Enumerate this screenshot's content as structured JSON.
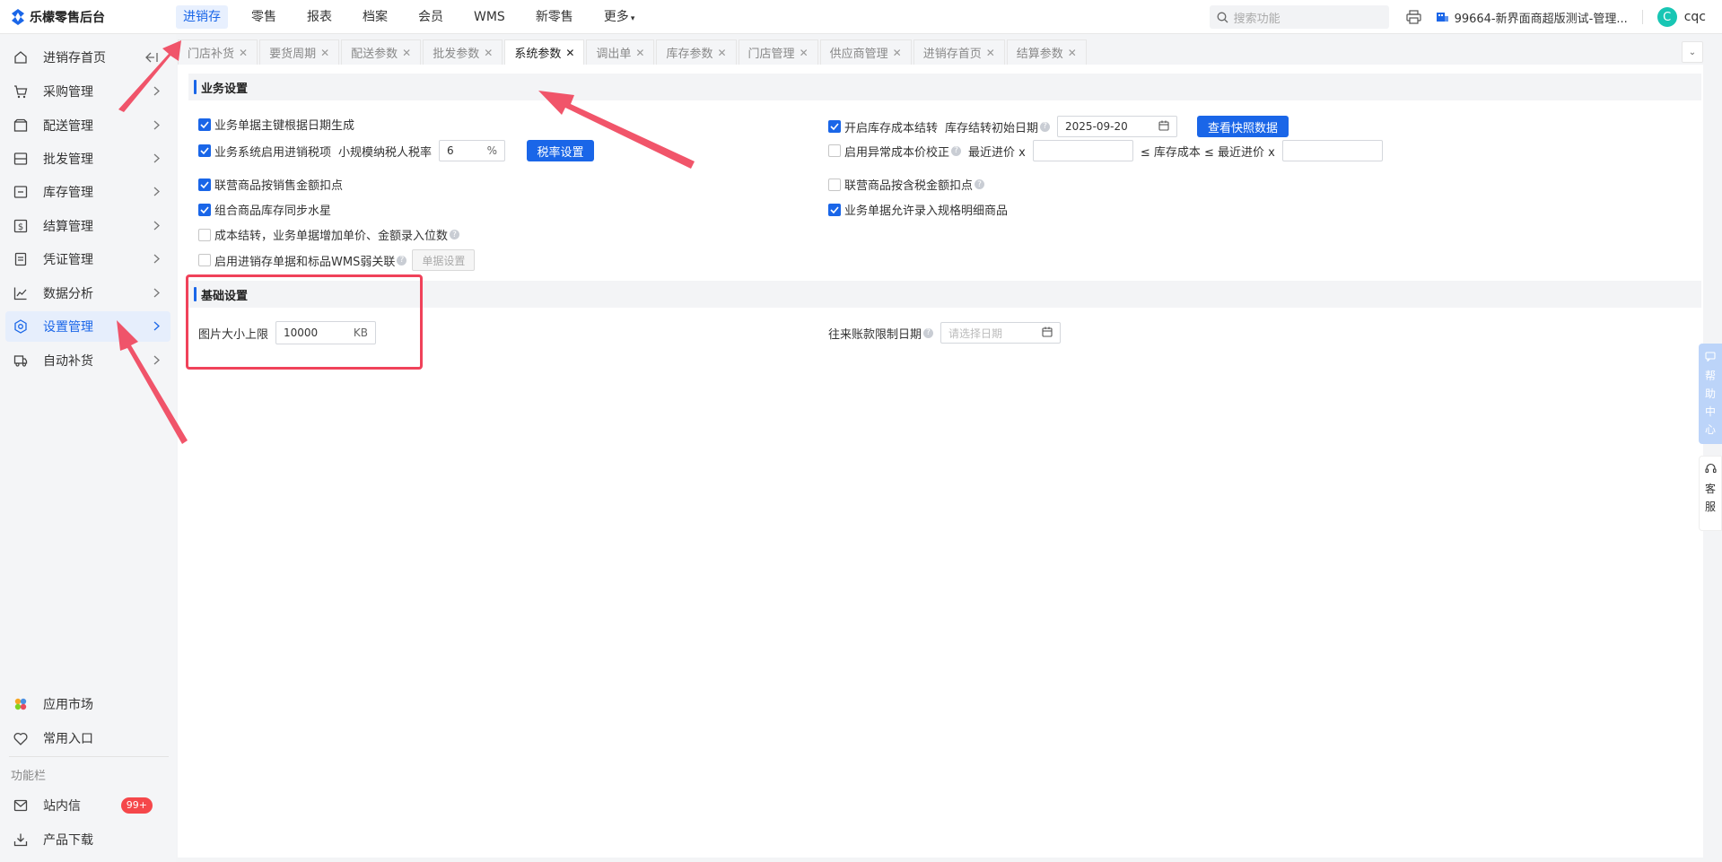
{
  "app": {
    "logo_text": "乐檬零售后台"
  },
  "topnav": {
    "items": [
      {
        "label": "进销存",
        "active": true
      },
      {
        "label": "零售"
      },
      {
        "label": "报表"
      },
      {
        "label": "档案"
      },
      {
        "label": "会员"
      },
      {
        "label": "WMS"
      },
      {
        "label": "新零售"
      },
      {
        "label": "更多"
      }
    ],
    "search_placeholder": "搜索功能",
    "store_name": "99664-新界面商超版测试-管理...",
    "user_initial": "C",
    "user_name": "cqc"
  },
  "sidebar": {
    "items": [
      {
        "label": "进销存首页"
      },
      {
        "label": "采购管理"
      },
      {
        "label": "配送管理"
      },
      {
        "label": "批发管理"
      },
      {
        "label": "库存管理"
      },
      {
        "label": "结算管理"
      },
      {
        "label": "凭证管理"
      },
      {
        "label": "数据分析"
      },
      {
        "label": "设置管理",
        "active": true
      },
      {
        "label": "自动补货"
      }
    ],
    "bottom": {
      "app_market": "应用市场",
      "favorites": "常用入口",
      "function_bar_label": "功能栏",
      "messages": "站内信",
      "messages_badge": "99+",
      "downloads": "产品下载"
    }
  },
  "tabs": [
    {
      "label": "门店补货"
    },
    {
      "label": "要货周期"
    },
    {
      "label": "配送参数"
    },
    {
      "label": "批发参数"
    },
    {
      "label": "系统参数",
      "active": true
    },
    {
      "label": "调出单"
    },
    {
      "label": "库存参数"
    },
    {
      "label": "门店管理"
    },
    {
      "label": "供应商管理"
    },
    {
      "label": "进销存首页"
    },
    {
      "label": "结算参数"
    }
  ],
  "business": {
    "title": "业务设置",
    "left": {
      "r1": {
        "label": "业务单据主键根据日期生成",
        "checked": true
      },
      "r2": {
        "label": "业务系统启用进销税项",
        "checked": true,
        "tax_label": "小规模纳税人税率",
        "tax_value": "6",
        "tax_unit": "%",
        "tax_button": "税率设置"
      },
      "r3": {
        "label": "联营商品按销售金额扣点",
        "checked": true
      },
      "r4": {
        "label": "组合商品库存同步水星",
        "checked": true
      },
      "r5": {
        "label": "成本结转，业务单据增加单价、金额录入位数",
        "checked": false
      },
      "r6": {
        "label": "启用进销存单据和标品WMS弱关联",
        "checked": false,
        "button": "单据设置"
      }
    },
    "right": {
      "r1": {
        "label": "开启库存成本结转",
        "checked": true,
        "date_label": "库存结转初始日期",
        "date_value": "2025-09-20",
        "button": "查看快照数据"
      },
      "r2": {
        "label": "启用异常成本价校正",
        "checked": false,
        "min_label": "最近进价 x",
        "mid_label": "≤ 库存成本 ≤ 最近进价 x"
      },
      "r3": {
        "label": "联营商品按含税金额扣点",
        "checked": false
      },
      "r4": {
        "label": "业务单据允许录入规格明细商品",
        "checked": true
      }
    }
  },
  "basic": {
    "title": "基础设置",
    "image_limit_label": "图片大小上限",
    "image_limit_value": "10000",
    "image_limit_unit": "KB",
    "ar_date_label": "往来账款限制日期",
    "ar_date_placeholder": "请选择日期"
  },
  "floating": {
    "help_center": [
      "帮",
      "助",
      "中",
      "心"
    ],
    "customer_service": [
      "客",
      "服"
    ]
  },
  "colors": {
    "primary": "#1a66e8",
    "highlight": "#f0425a",
    "arrow": "#f0425a"
  }
}
